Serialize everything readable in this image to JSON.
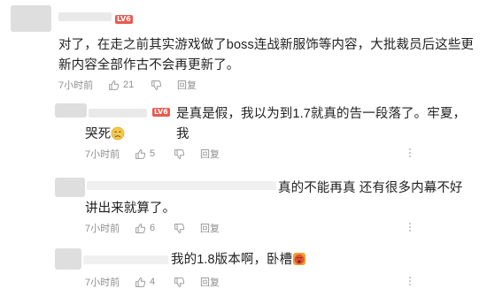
{
  "colors": {
    "text": "#222222",
    "meta": "#8f8f8f",
    "badge": "#e85a4f",
    "placeholder_gray": "#e9e9e9"
  },
  "comments": [
    {
      "badge": "LV6",
      "text_line1": "对了，在走之前其实游戏做了boss连战新服饰等内容，大批裁员后这些更",
      "text_line2": "新内容全部作古不会再更新了。",
      "time": "7小时前",
      "likes": "21",
      "reply": "回复"
    },
    {
      "badge": "LV6",
      "text_line1": "是真是假，我以为到1.7就真的告一段落了。牢夏，我",
      "text_line2": "哭死",
      "emoji": "crying-face-icon",
      "time": "7小时前",
      "likes": "5",
      "reply": "回复"
    },
    {
      "text_line1": "真的不能再真 还有很多内幕不好",
      "text_line2": "讲出来就算了。",
      "time": "7小时前",
      "likes": "6",
      "reply": "回复"
    },
    {
      "text_line1": "我的1.8版本啊，卧槽",
      "emoji": "crying-face-icon",
      "time": "7小时前",
      "likes": "4",
      "reply": "回复"
    }
  ]
}
